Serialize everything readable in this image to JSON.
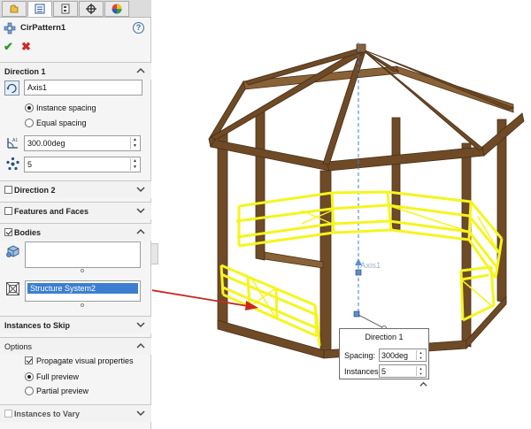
{
  "feature": {
    "title": "CirPattern1"
  },
  "direction1": {
    "header": "Direction 1",
    "axis_value": "Axis1",
    "spacing_options": [
      "Instance spacing",
      "Equal spacing"
    ],
    "selected_spacing": "Instance spacing",
    "angle_value": "300.00deg",
    "instances_value": "5"
  },
  "sections": {
    "direction2": "Direction 2",
    "features_faces": "Features and Faces",
    "bodies": "Bodies",
    "instances_to_skip": "Instances to Skip",
    "options": "Options",
    "instances_to_vary": "Instances to Vary"
  },
  "bodies": {
    "solid_bodies_list": [],
    "selected_bodies": [
      "Structure System2"
    ]
  },
  "options": {
    "propagate_visual_properties": "Propagate visual properties",
    "preview_options": [
      "Full preview",
      "Partial preview"
    ],
    "selected_preview": "Full preview"
  },
  "viewport": {
    "axis_label": "Axis1",
    "callout": {
      "title": "Direction 1",
      "spacing_label": "Spacing:",
      "spacing_value": "300deg",
      "instances_label": "Instances:",
      "instances_value": "5"
    }
  },
  "colors": {
    "wood": "#6e4a27",
    "wood_light": "#8a6238",
    "highlight": "#f5f51e",
    "arrow": "#c8281e",
    "selection": "#3c7fd1"
  },
  "icons": [
    "features-tab-icon",
    "property-manager-tab-icon",
    "configuration-manager-tab-icon",
    "dimxpert-tab-icon",
    "display-manager-tab-icon",
    "circular-pattern-icon",
    "help-icon",
    "ok-icon",
    "cancel-icon",
    "axis-direction-icon",
    "angle-icon",
    "instances-icon",
    "bodies-icon",
    "body-selection-icon",
    "chevron-up-icon",
    "chevron-down-icon"
  ]
}
